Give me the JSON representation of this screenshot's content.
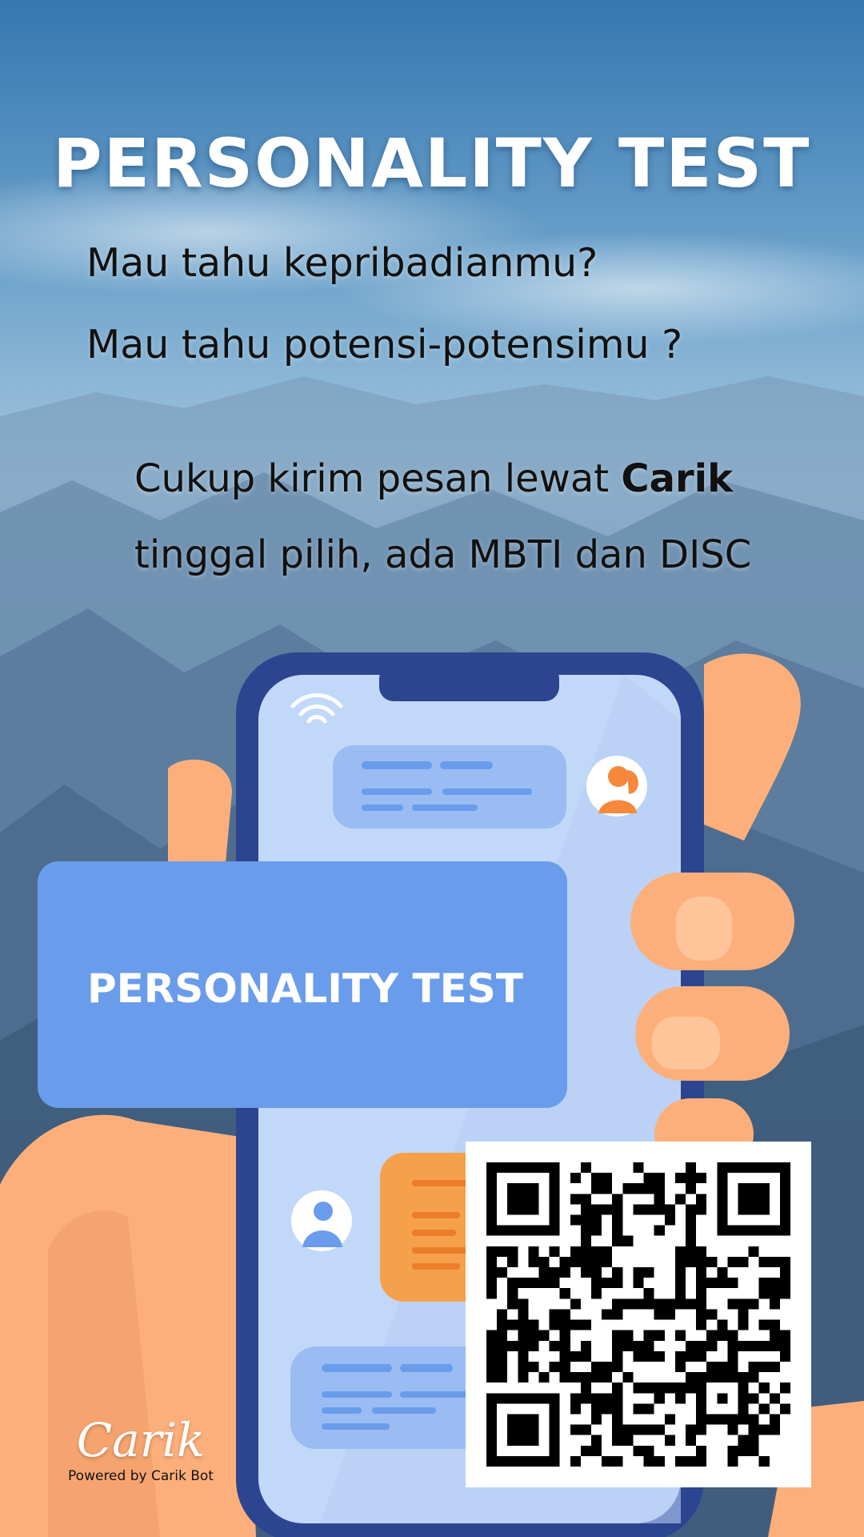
{
  "poster": {
    "headline": "PERSONALITY TEST",
    "question_1": "Mau tahu kepribadianmu?",
    "question_2": "Mau tahu potensi-potensimu ?",
    "cta_line1_pre": "Cukup kirim pesan lewat ",
    "cta_line1_brand": "Carik",
    "cta_line2": "tinggal pilih, ada MBTI dan DISC",
    "card_title": "PERSONALITY TEST",
    "logo_text": "Carik",
    "powered_by": "Powered by Carik Bot"
  },
  "colors": {
    "sky_top": "#3f7fb6",
    "sky_mid": "#a6c7df",
    "mountains": "#5a7a98",
    "phone_frame": "#2d4590",
    "phone_screen": "#c2d8f8",
    "banner": "#6a9cec",
    "hand": "#fdaf7b",
    "bubble_orange": "#f5a04a",
    "white": "#ffffff"
  },
  "icons": [
    "wifi-icon",
    "female-avatar-icon",
    "male-avatar-icon",
    "qr-code"
  ]
}
